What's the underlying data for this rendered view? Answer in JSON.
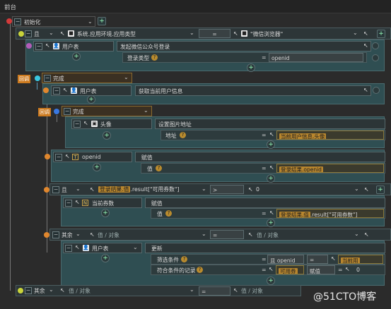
{
  "window": {
    "title": "前台"
  },
  "root": {
    "label": "初始化"
  },
  "and_row": {
    "op": "且",
    "left": "系统.应用环境.应用类型",
    "eq": "=",
    "right": "\"微信浏览器\""
  },
  "block1": {
    "node": "用户表",
    "action": "发起微信公众号登录",
    "param_label": "登录类型",
    "param_eq": "=",
    "param_value": "openid"
  },
  "callback_label": "回调",
  "done1": {
    "label": "完成"
  },
  "block2": {
    "node": "用户表",
    "action": "获取当前用户信息"
  },
  "done2": {
    "label": "完成"
  },
  "block3": {
    "node": "头像",
    "action": "设置图片地址",
    "param_label": "地址",
    "param_eq": "=",
    "param_value": "当前用户信息.头像"
  },
  "block4": {
    "node": "openid",
    "action": "赋值",
    "param_label": "值",
    "param_eq": "=",
    "param_value": "登录结果.openid"
  },
  "cond2": {
    "op": "且",
    "left_tag": "登录结果.值",
    "left_rest": ".result[\"可用券数\"]",
    "cmp": ">",
    "right": "0"
  },
  "block5": {
    "node": "当前券数",
    "action": "赋值",
    "param_label": "值",
    "param_eq": "=",
    "param_tag": "登录结果.值",
    "param_rest": ".result[\"可用券数\"]"
  },
  "else1": {
    "label": "其余",
    "placeholder": "值 / 对象",
    "eq": "=",
    "right": "值 / 对象"
  },
  "block6": {
    "node": "用户表",
    "action": "更新",
    "p1_label": "筛选条件",
    "p1_a": "且",
    "p1_b": "openid",
    "p1_eq": "=",
    "p1_val": "当前用",
    "p2_label": "符合条件的记录",
    "p2_eq": "=",
    "p2_a": "可用券",
    "p2_b": "赋值",
    "p2_eq2": "=",
    "p2_val": "0"
  },
  "else2": {
    "label": "其余",
    "placeholder": "值 / 对象",
    "eq": "=",
    "right": "值 / 对象"
  },
  "watermark": "@51CTO博客"
}
